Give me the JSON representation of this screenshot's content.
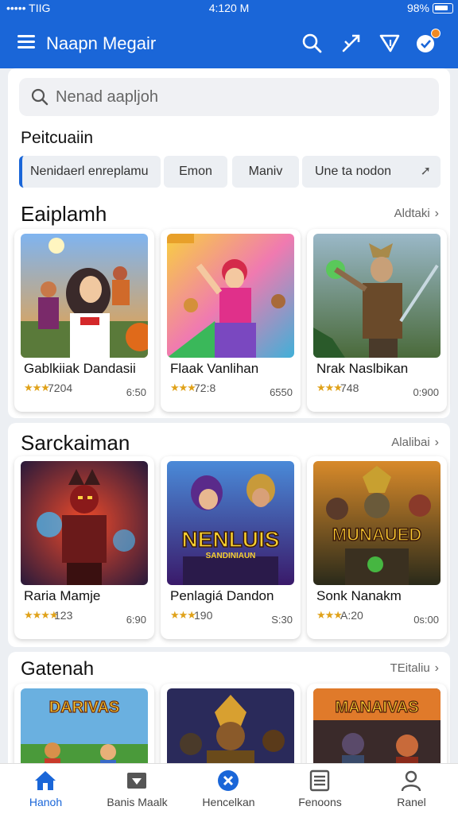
{
  "status_bar": {
    "carrier": "••••• TIIG",
    "time": "4:120 M",
    "battery": "98%"
  },
  "app_bar": {
    "title": "Naapn Megair",
    "icons": [
      "menu-icon",
      "search-icon",
      "game-tool-icon",
      "filter-icon",
      "notification-icon"
    ]
  },
  "search": {
    "placeholder": "Nenad aapljoh"
  },
  "filters": {
    "heading": "Peitcuaiin",
    "chips": [
      "Nenidaerl enreplamu",
      "Emon",
      "Maniv",
      "Une ta nodon"
    ]
  },
  "sections": [
    {
      "title": "Eaiplamh",
      "see_all": "Aldtaki",
      "games": [
        {
          "name": "Gablkiiak Dandasii",
          "stars": "★★★",
          "rating": "7204",
          "price": "6:50"
        },
        {
          "name": "Flaak Vanlihan",
          "stars": "★★★",
          "rating": "72:8",
          "price": "6550"
        },
        {
          "name": "Nrak Naslbikan",
          "stars": "★★★",
          "rating": "748",
          "price": "0:900"
        }
      ]
    },
    {
      "title": "Sarckaiman",
      "see_all": "Alalibai",
      "games": [
        {
          "name": "Raria Mamje",
          "stars": "★★★★",
          "rating": "123",
          "price": "6:90"
        },
        {
          "name": "Penlagiá Dandon",
          "stars": "★★★",
          "rating": "190",
          "price": "S:30",
          "logo_text": "NENLUIS",
          "logo_sub": "SANDINIAUN"
        },
        {
          "name": "Sonk Nanakm",
          "stars": "★★★",
          "rating": "A:20",
          "price": "0s:00",
          "logo_text": "MUNAUED"
        }
      ]
    },
    {
      "title": "Gatenah",
      "see_all": "TEitaliu",
      "games": [
        {
          "logo_text": "DARIVAS"
        },
        {
          "logo_text": ""
        },
        {
          "logo_text": "MANAIVAS"
        }
      ]
    }
  ],
  "bottom_nav": [
    {
      "label": "Hanoh",
      "icon": "home-icon",
      "active": true
    },
    {
      "label": "Banis Maalk",
      "icon": "cards-icon",
      "active": false
    },
    {
      "label": "Hencelkan",
      "icon": "x-badge-icon",
      "active": false
    },
    {
      "label": "Fenoons",
      "icon": "list-icon",
      "active": false
    },
    {
      "label": "Ranel",
      "icon": "profile-icon",
      "active": false
    }
  ],
  "colors": {
    "accent": "#1a66d8",
    "star": "#e0a21a",
    "badge": "#f08a24"
  }
}
